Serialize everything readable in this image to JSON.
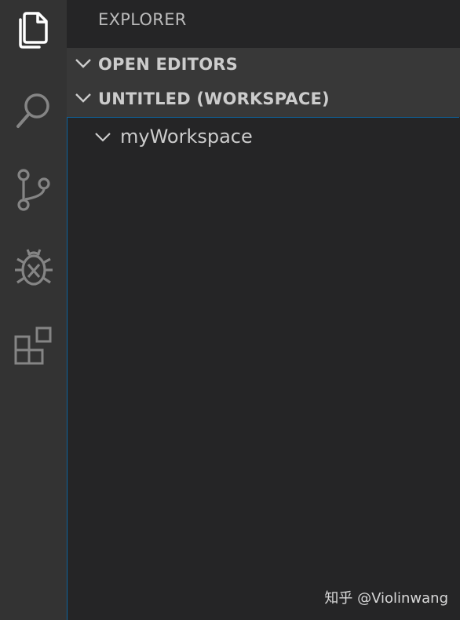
{
  "activity_bar": {
    "items": [
      {
        "name": "explorer",
        "icon": "files-icon"
      },
      {
        "name": "search",
        "icon": "search-icon"
      },
      {
        "name": "source-control",
        "icon": "source-control-icon"
      },
      {
        "name": "debug",
        "icon": "debug-icon"
      },
      {
        "name": "extensions",
        "icon": "extensions-icon"
      }
    ]
  },
  "sidebar": {
    "title": "EXPLORER",
    "sections": [
      {
        "label": "OPEN EDITORS"
      },
      {
        "label": "UNTITLED (WORKSPACE)"
      }
    ],
    "tree": {
      "items": [
        {
          "label": "myWorkspace"
        }
      ]
    }
  },
  "watermark": "知乎 @Violinwang",
  "colors": {
    "activity_bar_bg": "#333333",
    "sidebar_bg": "#252526",
    "section_header_bg": "#383838",
    "focus_border": "#0e639c",
    "text": "#cccccc"
  }
}
